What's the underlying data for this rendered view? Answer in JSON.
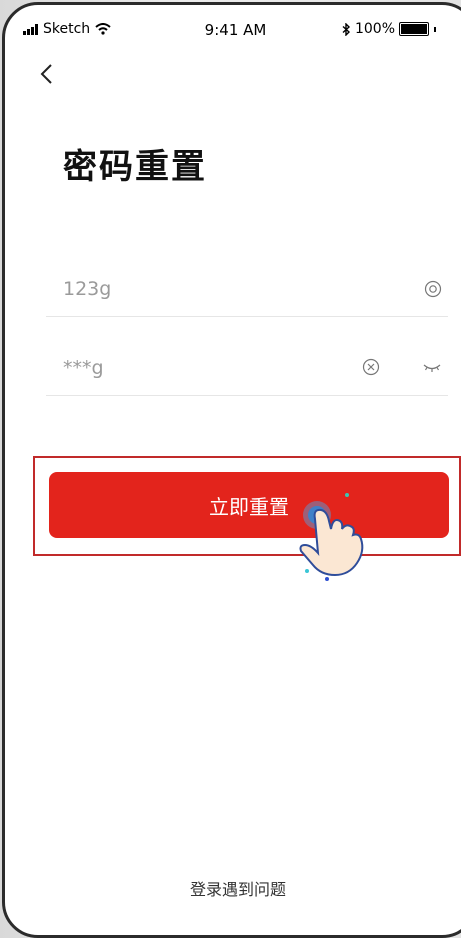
{
  "status_bar": {
    "carrier": "Sketch",
    "time": "9:41 AM",
    "battery": "100%"
  },
  "page": {
    "title": "密码重置"
  },
  "fields": [
    {
      "value": "123g",
      "icon": "eye-icon"
    },
    {
      "value": "***g",
      "icons": [
        "clear-icon",
        "eye-closed-icon"
      ]
    }
  ],
  "actions": {
    "reset_button": "立即重置",
    "help_link": "登录遇到问题"
  },
  "colors": {
    "accent": "#e3241c",
    "highlight_border": "#c12a2a",
    "text_muted": "#9a9a9a"
  }
}
